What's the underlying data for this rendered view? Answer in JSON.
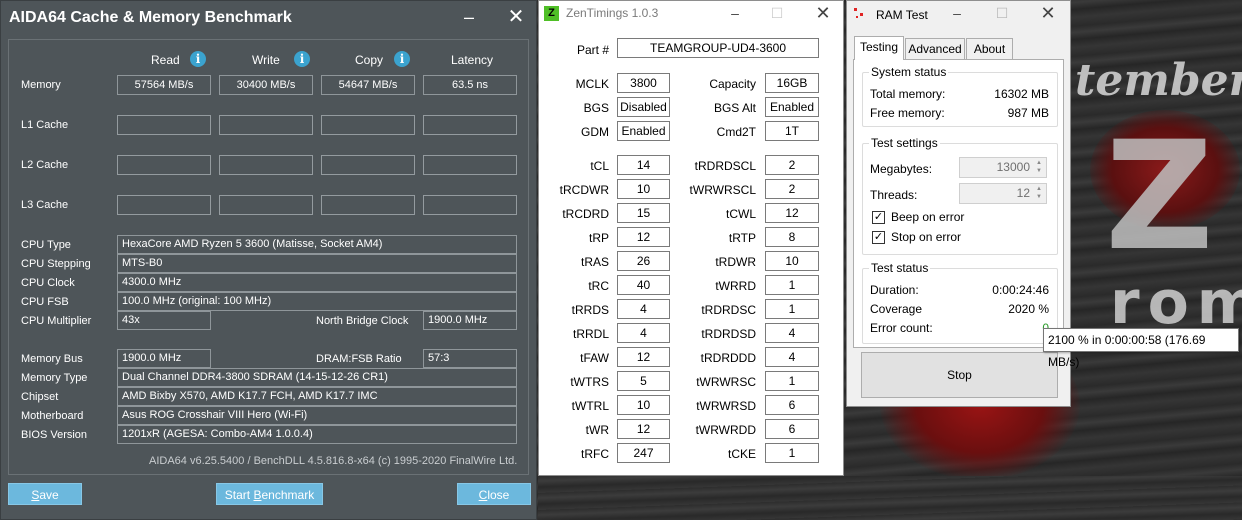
{
  "aida": {
    "title": "AIDA64 Cache & Memory Benchmark",
    "headers": {
      "read": "Read",
      "write": "Write",
      "copy": "Copy",
      "latency": "Latency"
    },
    "rows": {
      "memory": {
        "label": "Memory",
        "read": "57564 MB/s",
        "write": "30400 MB/s",
        "copy": "54647 MB/s",
        "latency": "63.5 ns"
      },
      "l1": {
        "label": "L1 Cache"
      },
      "l2": {
        "label": "L2 Cache"
      },
      "l3": {
        "label": "L3 Cache"
      }
    },
    "info": {
      "cpu_type": {
        "label": "CPU Type",
        "value": "HexaCore AMD Ryzen 5 3600  (Matisse, Socket AM4)"
      },
      "cpu_stepping": {
        "label": "CPU Stepping",
        "value": "MTS-B0"
      },
      "cpu_clock": {
        "label": "CPU Clock",
        "value": "4300.0 MHz"
      },
      "cpu_fsb": {
        "label": "CPU FSB",
        "value": "100.0 MHz  (original: 100 MHz)"
      },
      "cpu_multiplier": {
        "label": "CPU Multiplier",
        "value": "43x"
      },
      "north_bridge_clock": {
        "label": "North Bridge Clock",
        "value": "1900.0 MHz"
      },
      "memory_bus": {
        "label": "Memory Bus",
        "value": "1900.0 MHz"
      },
      "dram_fsb_ratio": {
        "label": "DRAM:FSB Ratio",
        "value": "57:3"
      },
      "memory_type": {
        "label": "Memory Type",
        "value": "Dual Channel DDR4-3800 SDRAM  (14-15-12-26 CR1)"
      },
      "chipset": {
        "label": "Chipset",
        "value": "AMD Bixby X570, AMD K17.7 FCH, AMD K17.7 IMC"
      },
      "motherboard": {
        "label": "Motherboard",
        "value": "Asus ROG Crosshair VIII Hero (Wi-Fi)"
      },
      "bios_version": {
        "label": "BIOS Version",
        "value": "1201xR  (AGESA: Combo-AM4 1.0.0.4)"
      }
    },
    "footer": "AIDA64 v6.25.5400 / BenchDLL 4.5.816.8-x64  (c) 1995-2020 FinalWire Ltd.",
    "buttons": {
      "save_first": "S",
      "save_rest": "ave",
      "start_pre": "Start ",
      "start_u": "B",
      "start_rest": "enchmark",
      "close_first": "C",
      "close_rest": "lose"
    }
  },
  "zen": {
    "logo": "Z",
    "title": "ZenTimings 1.0.3",
    "part_label": "Part #",
    "part_value": "TEAMGROUP-UD4-3600",
    "left": [
      {
        "label": "MCLK",
        "value": "3800"
      },
      {
        "label": "BGS",
        "value": "Disabled"
      },
      {
        "label": "GDM",
        "value": "Enabled"
      },
      {
        "label": "tCL",
        "value": "14"
      },
      {
        "label": "tRCDWR",
        "value": "10"
      },
      {
        "label": "tRCDRD",
        "value": "15"
      },
      {
        "label": "tRP",
        "value": "12"
      },
      {
        "label": "tRAS",
        "value": "26"
      },
      {
        "label": "tRC",
        "value": "40"
      },
      {
        "label": "tRRDS",
        "value": "4"
      },
      {
        "label": "tRRDL",
        "value": "4"
      },
      {
        "label": "tFAW",
        "value": "12"
      },
      {
        "label": "tWTRS",
        "value": "5"
      },
      {
        "label": "tWTRL",
        "value": "10"
      },
      {
        "label": "tWR",
        "value": "12"
      },
      {
        "label": "tRFC",
        "value": "247"
      }
    ],
    "right": [
      {
        "label": "Capacity",
        "value": "16GB"
      },
      {
        "label": "BGS Alt",
        "value": "Enabled"
      },
      {
        "label": "Cmd2T",
        "value": "1T"
      },
      {
        "label": "tRDRDSCL",
        "value": "2"
      },
      {
        "label": "tWRWRSCL",
        "value": "2"
      },
      {
        "label": "tCWL",
        "value": "12"
      },
      {
        "label": "tRTP",
        "value": "8"
      },
      {
        "label": "tRDWR",
        "value": "10"
      },
      {
        "label": "tWRRD",
        "value": "1"
      },
      {
        "label": "tRDRDSC",
        "value": "1"
      },
      {
        "label": "tRDRDSD",
        "value": "4"
      },
      {
        "label": "tRDRDDD",
        "value": "4"
      },
      {
        "label": "tWRWRSC",
        "value": "1"
      },
      {
        "label": "tWRWRSD",
        "value": "6"
      },
      {
        "label": "tWRWRDD",
        "value": "6"
      },
      {
        "label": "tCKE",
        "value": "1"
      }
    ]
  },
  "ram": {
    "title": "RAM Test",
    "tabs": [
      "Testing",
      "Advanced",
      "About"
    ],
    "system_status": {
      "title": "System status",
      "total_label": "Total memory:",
      "total_value": "16302 MB",
      "free_label": "Free memory:",
      "free_value": "987 MB"
    },
    "test_settings": {
      "title": "Test settings",
      "megabytes_label": "Megabytes:",
      "megabytes_value": "13000",
      "threads_label": "Threads:",
      "threads_value": "12",
      "beep_label": "Beep on error",
      "beep_checked": true,
      "stop_label": "Stop on error",
      "stop_checked": true
    },
    "test_status": {
      "title": "Test status",
      "duration_label": "Duration:",
      "duration_value": "0:00:24:46",
      "coverage_label": "Coverage",
      "coverage_value": "2020 %",
      "error_label": "Error count:",
      "error_value": "0"
    },
    "stop_button": "Stop",
    "tooltip": "2100 % in 0:00:00:58 (176.69 MB/s)"
  },
  "background": {
    "line1": "tember",
    "line2": "Z",
    "line3": "rom"
  }
}
